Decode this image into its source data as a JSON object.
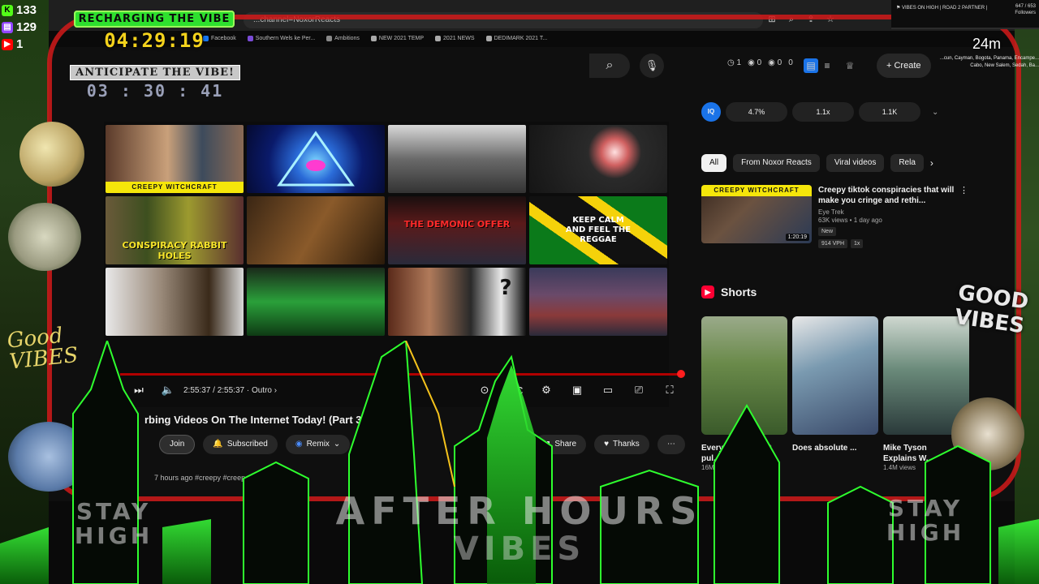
{
  "colors": {
    "accent_red": "#d11a1a",
    "neon_green": "#2ee02e",
    "timer_yellow": "#f4d21c",
    "yt_bg": "#0f0f0f",
    "youtube_blue": "#1a73e8"
  },
  "browser": {
    "url": "...channel=NoxorReacts",
    "bookmarks": [
      "Facebook",
      "Southern Wels ke Per...",
      "Ambitions",
      "NEW 2021 TEMP",
      "2021 NEWS",
      "DEDIMARK 2021 T..."
    ]
  },
  "overlay": {
    "counters": [
      {
        "icon": "kick-icon",
        "value": "133"
      },
      {
        "icon": "twitch-icon",
        "value": "129"
      },
      {
        "icon": "youtube-icon",
        "value": "1"
      }
    ],
    "recharging_label": "RECHARGING THE VIBE",
    "recharging_time": "04:29:19",
    "anticipate_label": "ANTICIPATE THE VIBE!",
    "anticipate_time": "03 : 30 : 41",
    "widget_title": "VIBES ON HIGH | ROAD 2 PARTNER |",
    "widget_count": "647 / 653",
    "widget_count_label": "Followers",
    "minutes_label": "24m",
    "ticker_text": "...cun, Cayman, Bogota, Panama, Encampe... Cabo, New Salem, Sedah, Ba...",
    "good_vibes_left": "Good VIBES",
    "good_vibes_right": "GOOD VIBES",
    "after_hours": "AFTER HOURS",
    "vibes": "VIBES",
    "stay_high_left": "STAY HIGH",
    "stay_high_right": "STAY HIGH"
  },
  "youtube": {
    "header_stats": [
      "1",
      "0",
      "0",
      "0"
    ],
    "create_label": "Create",
    "player": {
      "tiles": [
        {
          "label": "CREEPY WITCHCRAFT",
          "kind": "banner"
        },
        {
          "label": "",
          "kind": "pyramid"
        },
        {
          "label": "",
          "kind": "wrestling"
        },
        {
          "label": "",
          "kind": "hooded"
        },
        {
          "label": "CONSPIRACY RABBIT HOLES",
          "kind": "text"
        },
        {
          "label": "",
          "kind": "sepia"
        },
        {
          "label": "THE DEMONIC OFFER",
          "kind": "text"
        },
        {
          "label": "KEEP CALM AND FEEL THE REGGAE",
          "kind": "jamaica"
        },
        {
          "label": "",
          "kind": "man"
        },
        {
          "label": "",
          "kind": "gun"
        },
        {
          "label": "?",
          "kind": "faces"
        },
        {
          "label": "",
          "kind": "anime"
        }
      ],
      "time": "2:55:37 / 2:55:37",
      "chapter": "Outro"
    },
    "video_title": "rbing Videos On The Internet Today! (Part 3",
    "actions": {
      "join": "Join",
      "subscribed": "Subscribed",
      "remix": "Remix",
      "share": "Share",
      "thanks": "Thanks"
    },
    "meta": "7 hours ago  #creepy #creep...",
    "sidebar": {
      "logo_label": "IQ",
      "stats": [
        "4.7%",
        "1.1x",
        "1.1K"
      ],
      "chips": [
        "All",
        "From Noxor Reacts",
        "Viral videos",
        "Rela"
      ],
      "rec": {
        "banner": "CREEPY WITCHCRAFT",
        "duration": "1:20:19",
        "title": "Creepy tiktok conspiracies that will make you cringe and rethi...",
        "channel": "Eye Trek",
        "views": "63K views • 1 day ago",
        "badge_new": "New",
        "vph": "914 VPH",
        "mult": "1x"
      },
      "shorts_label": "Shorts",
      "shorts": [
        {
          "title": "Everyone couldn't pul...",
          "views": "16M views"
        },
        {
          "title": "Does absolute ...",
          "views": ""
        },
        {
          "title": "Mike Tyson Explains W...",
          "views": "1.4M views"
        }
      ]
    }
  }
}
